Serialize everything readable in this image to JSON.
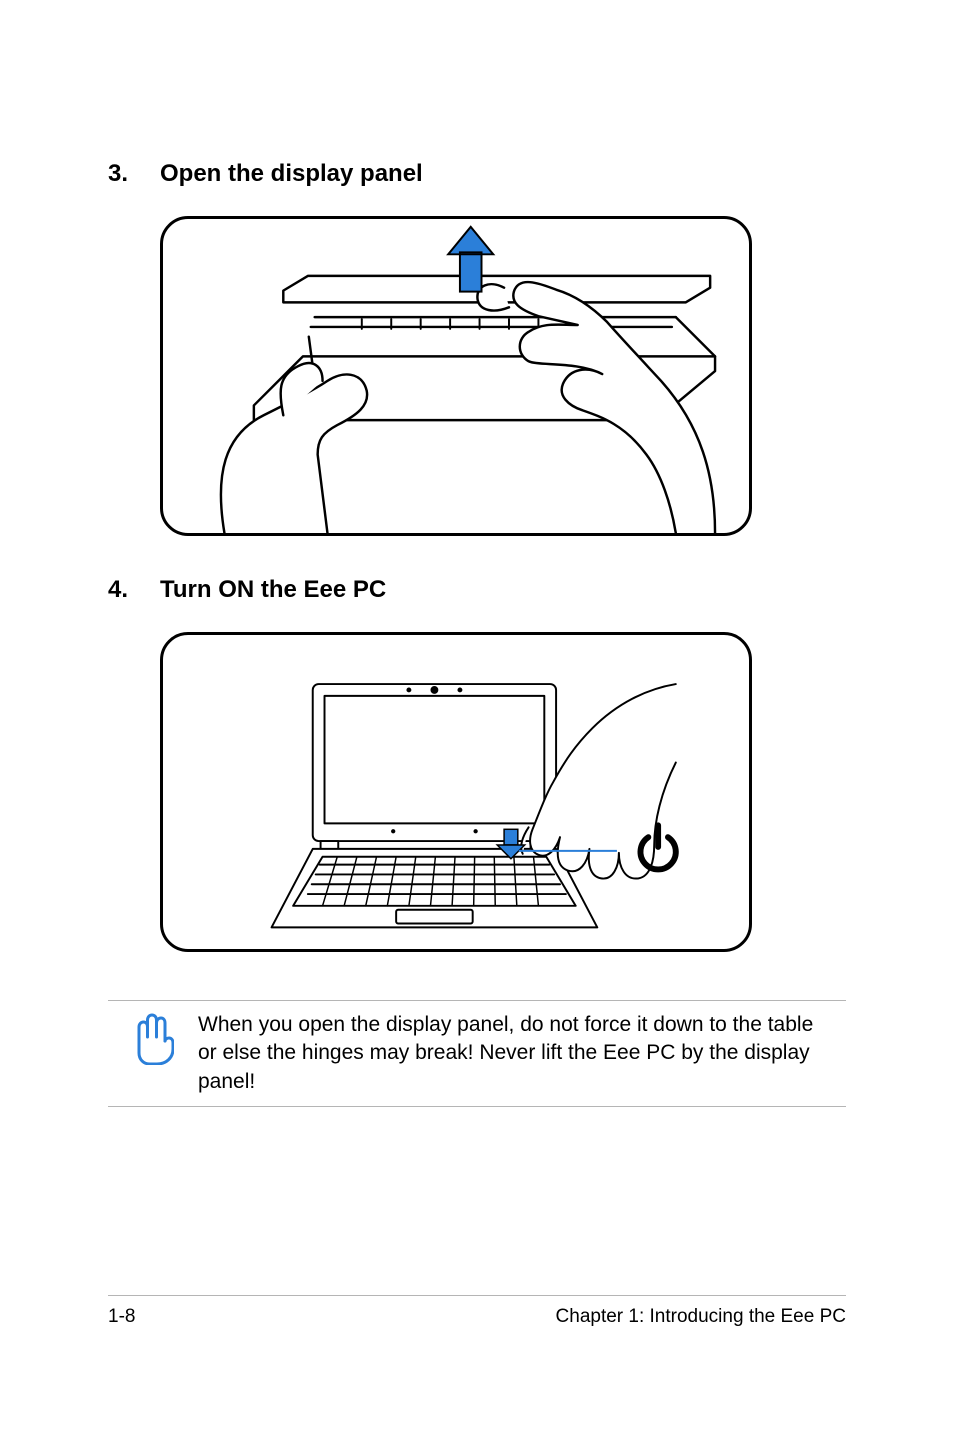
{
  "steps": [
    {
      "number": "3.",
      "title": "Open the display panel"
    },
    {
      "number": "4.",
      "title": "Turn ON the Eee PC"
    }
  ],
  "note": {
    "text": "When you open the display panel, do not force it down to the table or else the hinges may break! Never lift the Eee PC by the display panel!"
  },
  "footer": {
    "pageNumber": "1-8",
    "chapterTitle": "Chapter 1: Introducing the Eee PC"
  }
}
